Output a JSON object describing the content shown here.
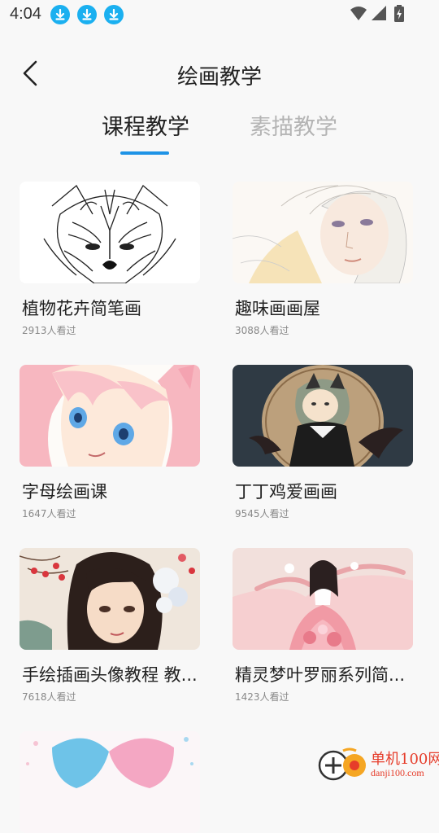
{
  "status_bar": {
    "time": "4:04",
    "notification_icons": [
      "download-icon",
      "download-icon",
      "download-icon"
    ],
    "system_icons": [
      "wifi-icon",
      "signal-icon",
      "battery-charging-icon"
    ]
  },
  "header": {
    "back_icon": "chevron-left-icon",
    "title": "绘画教学"
  },
  "tabs": [
    {
      "label": "课程教学",
      "active": true
    },
    {
      "label": "素描教学",
      "active": false
    }
  ],
  "colors": {
    "accent": "#1e93e6",
    "tab_inactive": "#b4b4b4",
    "download_badge": "#1bb0f0",
    "watermark": "#e63c2a"
  },
  "courses": [
    {
      "title": "植物花卉简笔画",
      "views": "2913人看过"
    },
    {
      "title": "趣味画画屋",
      "views": "3088人看过"
    },
    {
      "title": "字母绘画课",
      "views": "1647人看过"
    },
    {
      "title": "丁丁鸡爱画画",
      "views": "9545人看过"
    },
    {
      "title": "手绘插画头像教程 教...",
      "views": "7618人看过"
    },
    {
      "title": "精灵梦叶罗丽系列简...",
      "views": "1423人看过"
    }
  ],
  "watermark": {
    "name": "单机100网",
    "url": "danji100.com"
  }
}
